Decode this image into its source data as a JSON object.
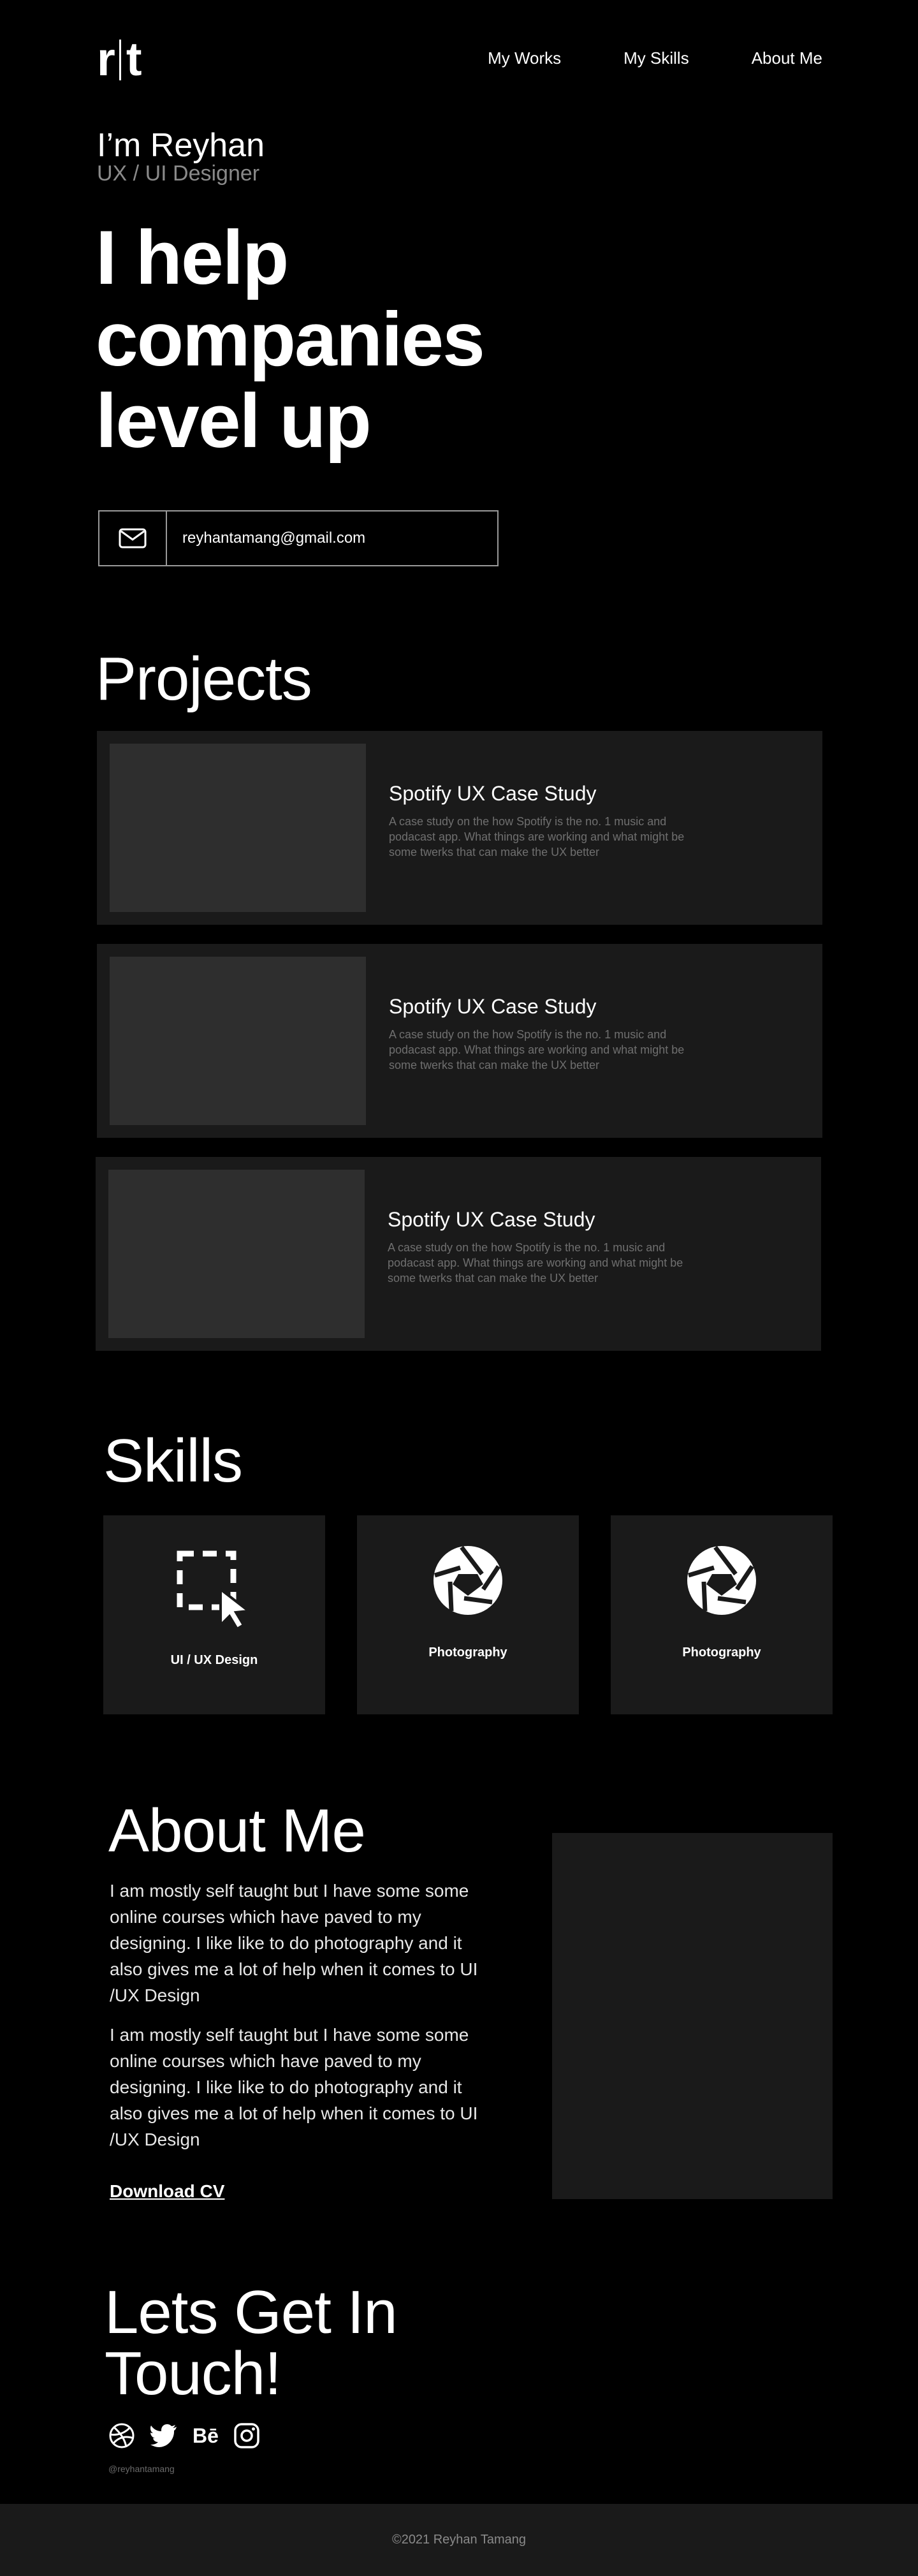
{
  "header": {
    "logo_left": "r",
    "logo_right": "t",
    "nav": [
      "My Works",
      "My Skills",
      "About Me"
    ]
  },
  "hero": {
    "greeting": "I’m Reyhan",
    "role": "UX / UI Designer",
    "headline_lines": [
      "I help",
      "companies",
      "level up"
    ],
    "email": "reyhantamang@gmail.com"
  },
  "projects": {
    "title": "Projects",
    "items": [
      {
        "title": "Spotify UX Case Study",
        "description": "A case study on the how Spotify is the no. 1 music and podacast app. What things are working and what might be some twerks that can make the UX better"
      },
      {
        "title": "Spotify UX Case Study",
        "description": "A case study on the how Spotify is the no. 1 music and podacast app. What things are working and what might be some twerks that can make the UX better"
      },
      {
        "title": "Spotify UX Case Study",
        "description": "A case study on the how Spotify is the no. 1 music and podacast app. What things are working and what might be some twerks that can make the UX better"
      }
    ]
  },
  "skills": {
    "title": "Skills",
    "items": [
      {
        "label": "UI / UX Design",
        "icon": "selection-cursor-icon"
      },
      {
        "label": "Photography",
        "icon": "camera-aperture-icon"
      },
      {
        "label": "Photography",
        "icon": "camera-aperture-icon"
      }
    ]
  },
  "about": {
    "title": "About Me",
    "paragraphs": [
      "I am mostly self taught but I have some some online courses which have paved to my designing. I like like to do photography and it also gives me a lot of help when it comes to UI /UX Design",
      "I am mostly self taught but I have some some online courses which have paved to my designing. I like like to do photography and it also gives me a lot of help when it comes to UI /UX Design"
    ],
    "download": "Download CV"
  },
  "contact": {
    "title_lines": [
      "Lets Get In",
      "Touch!"
    ],
    "socials": [
      "dribbble-icon",
      "twitter-icon",
      "behance-icon",
      "instagram-icon"
    ],
    "behance_text": "Bē",
    "handle": "@reyhantamang"
  },
  "footer": {
    "copyright": "©2021 Reyhan Tamang"
  }
}
